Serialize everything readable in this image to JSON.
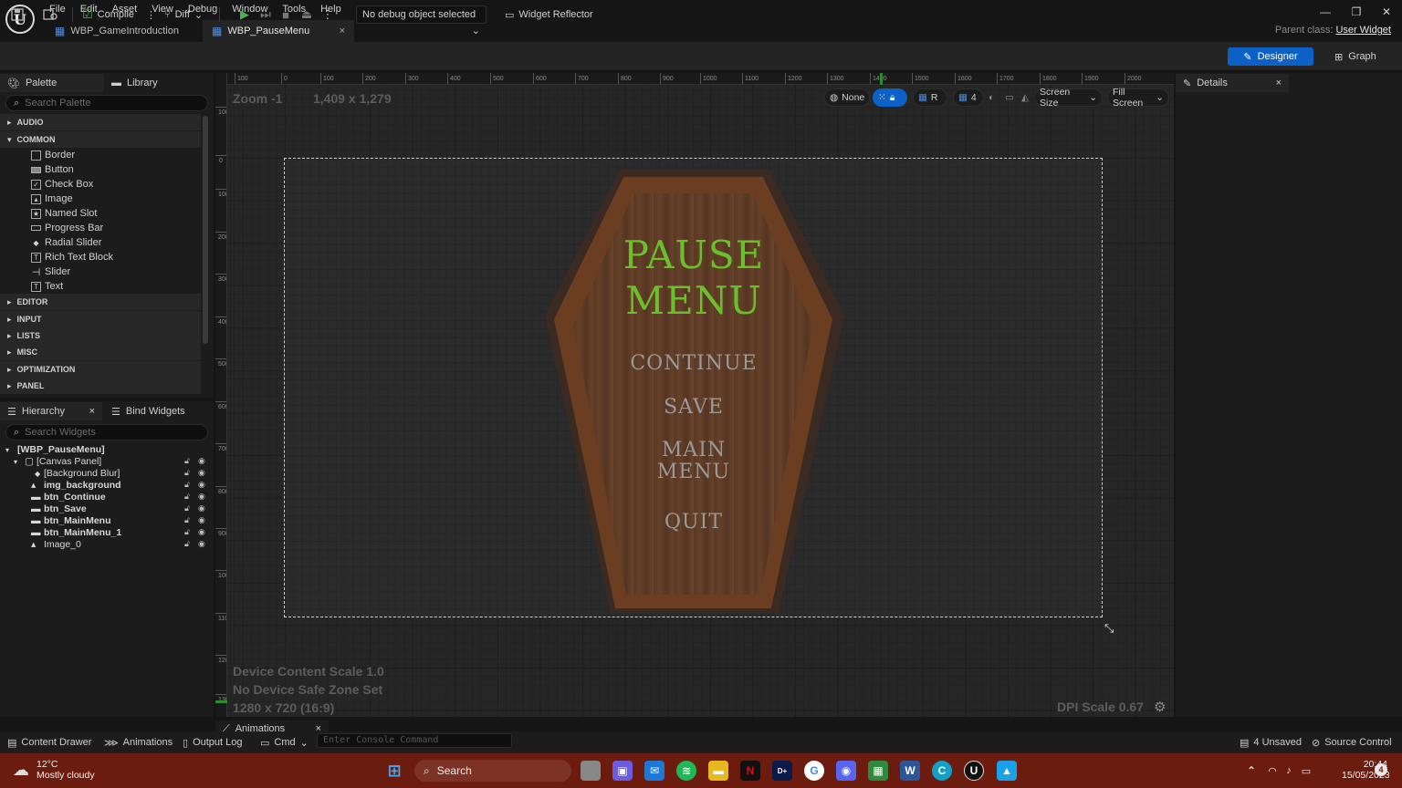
{
  "menu": [
    "File",
    "Edit",
    "Asset",
    "View",
    "Debug",
    "Window",
    "Tools",
    "Help"
  ],
  "tabs": [
    {
      "label": "WBP_GameIntroduction"
    },
    {
      "label": "WBP_PauseMenu",
      "close": "×"
    }
  ],
  "window_controls": {
    "minimize": "—",
    "restore": "❐",
    "close": "✕"
  },
  "parent_class": {
    "label": "Parent class:",
    "value": "User Widget"
  },
  "toolbar": {
    "compile": "Compile",
    "diff": "Diff",
    "debug_select": "No debug object selected",
    "widget_reflector": "Widget Reflector",
    "designer": "Designer",
    "graph": "Graph"
  },
  "palette": {
    "tab_palette": "Palette",
    "tab_library": "Library",
    "search_placeholder": "Search Palette",
    "categories": {
      "audio": "AUDIO",
      "common": "COMMON",
      "editor": "EDITOR",
      "input": "INPUT",
      "lists": "LISTS",
      "misc": "MISC",
      "optimization": "OPTIMIZATION",
      "panel": "PANEL"
    },
    "common_items": [
      "Border",
      "Button",
      "Check Box",
      "Image",
      "Named Slot",
      "Progress Bar",
      "Radial Slider",
      "Rich Text Block",
      "Slider",
      "Text"
    ]
  },
  "hierarchy": {
    "tab_hierarchy": "Hierarchy",
    "tab_bind": "Bind Widgets",
    "close": "×",
    "search_placeholder": "Search Widgets",
    "root": "[WBP_PauseMenu]",
    "canvas": "[Canvas Panel]",
    "items": [
      "[Background Blur]",
      "img_background",
      "btn_Continue",
      "btn_Save",
      "btn_MainMenu",
      "btn_MainMenu_1",
      "Image_0"
    ]
  },
  "viewport": {
    "zoom": "Zoom -1",
    "resolution": "1,409 x 1,279",
    "none": "None",
    "r": "R",
    "grid_count": "4",
    "screen_size": "Screen Size",
    "fill_screen": "Fill Screen",
    "ruler_top": [
      "100",
      "0",
      "100",
      "200",
      "300",
      "400",
      "500",
      "600",
      "700",
      "800",
      "900",
      "1000",
      "1100",
      "1200",
      "1300",
      "1400",
      "1500",
      "1600",
      "1700",
      "1800",
      "1900",
      "2000"
    ],
    "ruler_left": [
      "100",
      "0",
      "100",
      "200",
      "300",
      "400",
      "500",
      "600",
      "700",
      "800",
      "900",
      "1000",
      "1100",
      "1200",
      "1300"
    ],
    "device_content_scale": "Device Content Scale 1.0",
    "safe_zone": "No Device Safe Zone Set",
    "device_size": "1280 x 720 (16:9)",
    "dpi_scale": "DPI Scale 0.67"
  },
  "pause_menu": {
    "title_line1": "PAUSE",
    "title_line2": "MENU",
    "continue": "CONTINUE",
    "save": "SAVE",
    "main_line1": "MAIN",
    "main_line2": "MENU",
    "quit": "QUIT",
    "title_color": "#6bbf2c",
    "button_color": "#9b9a9a"
  },
  "details": {
    "title": "Details",
    "close": "×"
  },
  "bottom": {
    "animations_tab": "Animations",
    "close": "×",
    "content_drawer": "Content Drawer",
    "animations": "Animations",
    "output_log": "Output Log",
    "cmd": "Cmd",
    "console_placeholder": "Enter Console Command",
    "unsaved": "4 Unsaved",
    "source_control": "Source Control"
  },
  "taskbar": {
    "temperature": "12°C",
    "weather": "Mostly cloudy",
    "search": "Search",
    "time": "20:44",
    "date": "15/05/2023",
    "notifications": "4",
    "accent": "#6b1c0f"
  }
}
